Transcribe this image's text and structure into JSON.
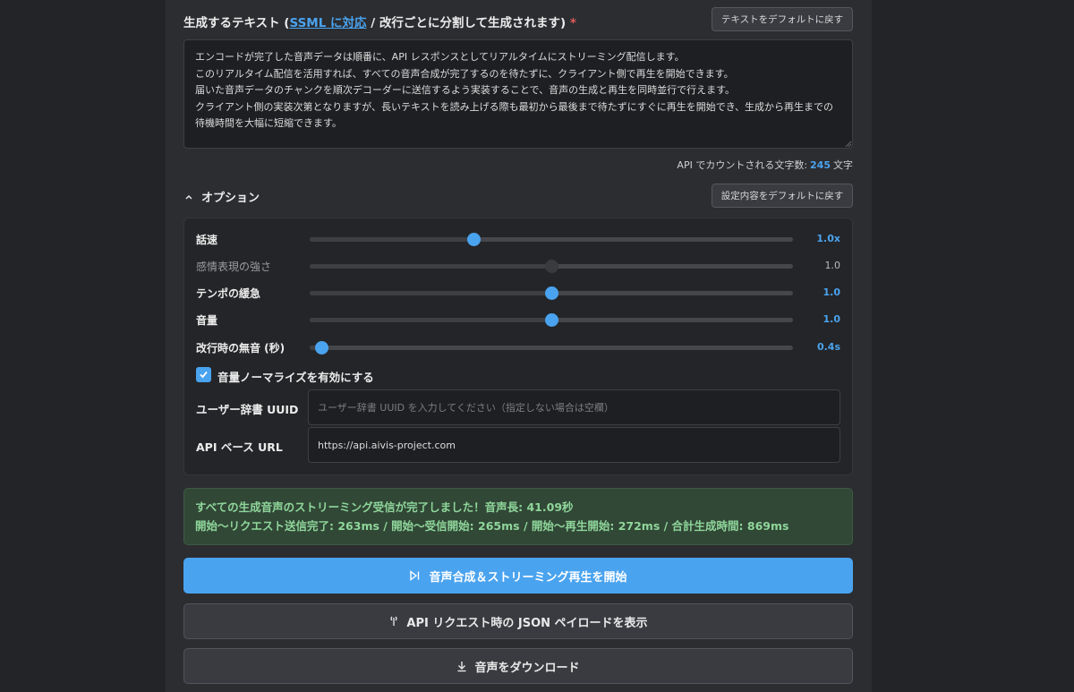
{
  "text_section": {
    "label_prefix": "生成するテキスト (",
    "ssml_link": "SSML に対応",
    "label_suffix": " / 改行ごとに分割して生成されます)",
    "required_mark": "*",
    "reset_button": "テキストをデフォルトに戻す",
    "text": "エンコードが完了した音声データは順番に、API レスポンスとしてリアルタイムにストリーミング配信します。\nこのリアルタイム配信を活用すれば、すべての音声合成が完了するのを待たずに、クライアント側で再生を開始できます。\n届いた音声データのチャンクを順次デコーダーに送信するよう実装することで、音声の生成と再生を同時並行で行えます。\nクライアント側の実装次第となりますが、長いテキストを読み上げる際も最初から最後まで待たずにすぐに再生を開始でき、生成から再生までの待機時間を大幅に短縮できます。",
    "count_prefix": "API でカウントされる文字数:",
    "count_value": "245",
    "count_suffix": "文字"
  },
  "options": {
    "title": "オプション",
    "reset_button": "設定内容をデフォルトに戻す",
    "sliders": [
      {
        "label": "話速",
        "value_text": "1.0x",
        "fraction": 0.34,
        "dim": false
      },
      {
        "label": "感情表現の強さ",
        "value_text": "1.0",
        "fraction": 0.5,
        "dim": true
      },
      {
        "label": "テンポの緩急",
        "value_text": "1.0",
        "fraction": 0.5,
        "dim": false
      },
      {
        "label": "音量",
        "value_text": "1.0",
        "fraction": 0.5,
        "dim": false
      },
      {
        "label": "改行時の無音 (秒)",
        "value_text": "0.4s",
        "fraction": 0.02,
        "dim": false
      }
    ],
    "normalize_label": "音量ノーマライズを有効にする",
    "normalize_checked": true,
    "dict_label": "ユーザー辞書 UUID",
    "dict_placeholder": "ユーザー辞書 UUID を入力してください（指定しない場合は空欄）",
    "api_label": "API ベース URL",
    "api_value": "https://api.aivis-project.com"
  },
  "status": {
    "line1": "すべての生成音声のストリーミング受信が完了しました！音声長: 41.09秒",
    "line2": "開始〜リクエスト送信完了: 263ms / 開始〜受信開始: 265ms / 開始〜再生開始: 272ms / 合計生成時間: 869ms"
  },
  "buttons": {
    "start": "音声合成＆ストリーミング再生を開始",
    "payload": "API リクエスト時の JSON ペイロードを表示",
    "download": "音声をダウンロード"
  },
  "colors": {
    "accent": "#4aa3ef",
    "success_bg": "#314836",
    "success_text": "#8fd69b",
    "required": "#e25b5b"
  },
  "icons": [
    "chevron-up-icon",
    "check-icon",
    "play-stream-icon",
    "code-icon",
    "download-icon"
  ]
}
